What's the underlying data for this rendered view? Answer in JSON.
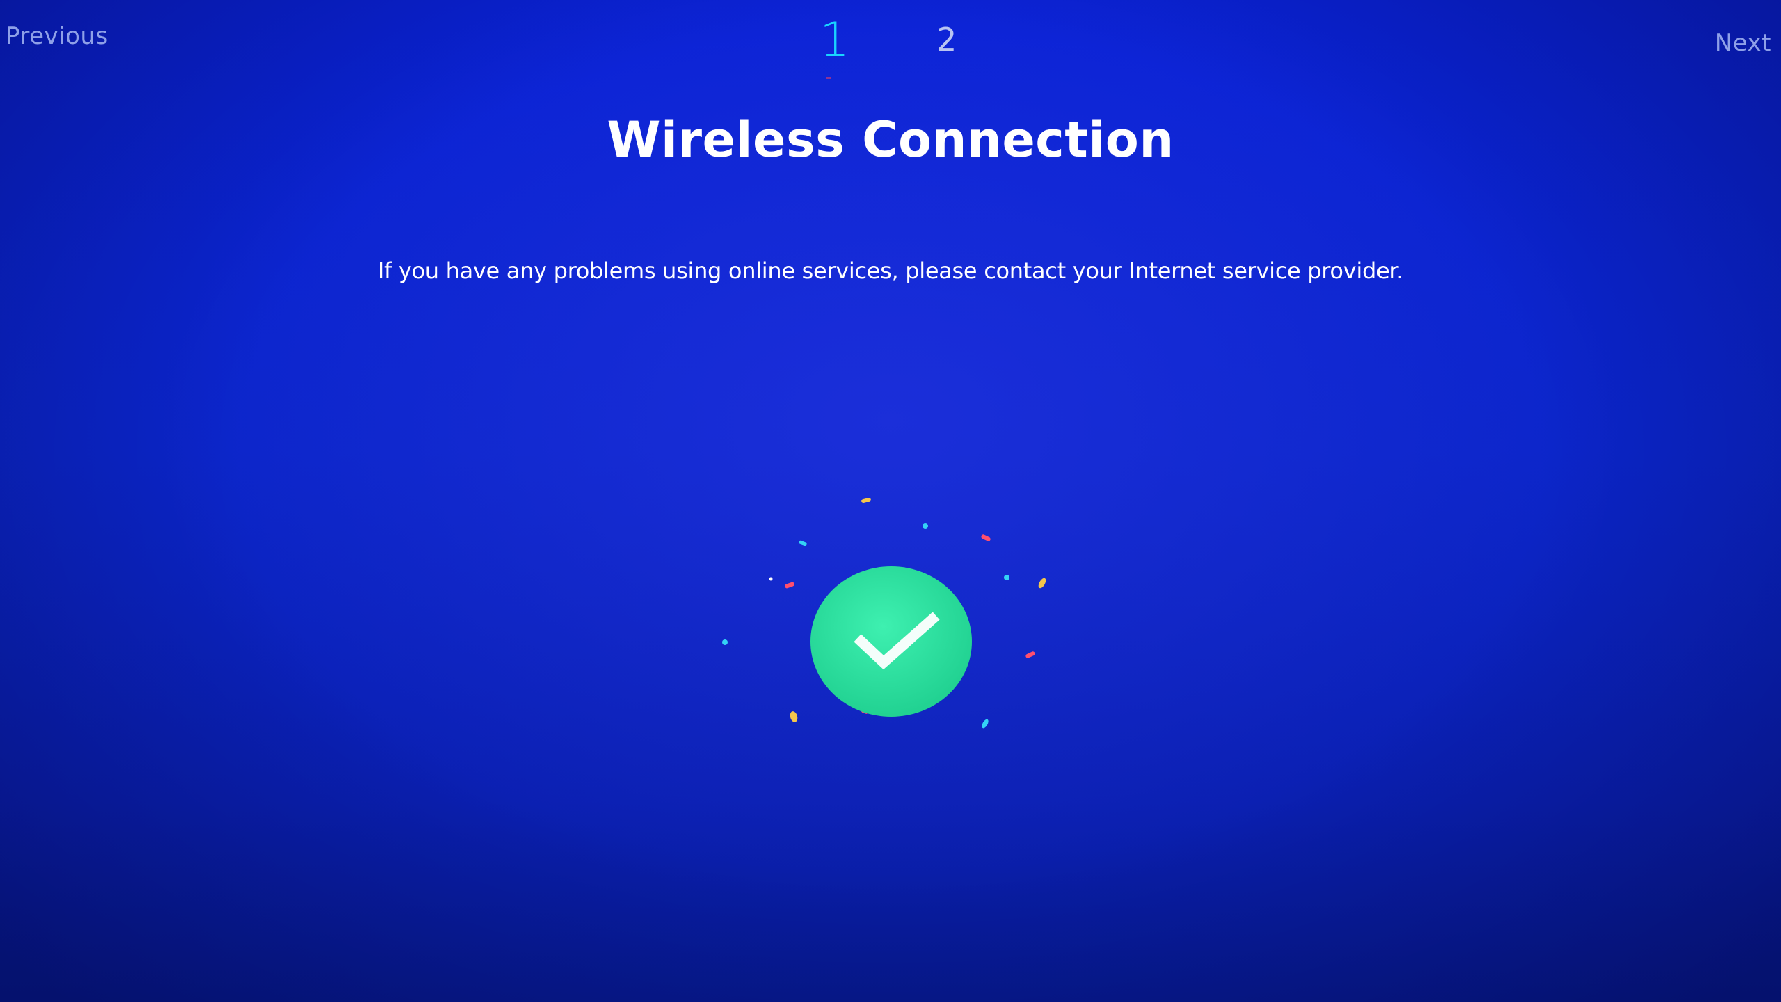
{
  "nav": {
    "previous_label": "Previous",
    "next_label": "Next"
  },
  "steps": [
    {
      "label": "1",
      "active": true
    },
    {
      "label": "2",
      "active": false
    }
  ],
  "page": {
    "title": "Wireless Connection",
    "message": "If you have any problems using online services, please contact your Internet service provider."
  },
  "status": {
    "icon": "checkmark-icon",
    "state": "success"
  },
  "colors": {
    "background": "#0b25c9",
    "accent_step": "#19d4ff",
    "success_circle": "#2ee0a0",
    "nav_text": "#8ea0e8"
  }
}
